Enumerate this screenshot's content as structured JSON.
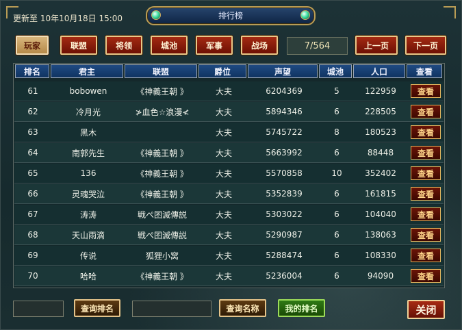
{
  "header": {
    "update_text": "更新至 10年10月18日 15:00",
    "title": "排行榜"
  },
  "tabs": [
    {
      "label": "玩家",
      "active": true
    },
    {
      "label": "联盟",
      "active": false
    },
    {
      "label": "将领",
      "active": false
    },
    {
      "label": "城池",
      "active": false
    },
    {
      "label": "军事",
      "active": false
    },
    {
      "label": "战场",
      "active": false
    }
  ],
  "pager": {
    "indicator": "7/564",
    "prev_label": "上一页",
    "next_label": "下一页"
  },
  "table": {
    "columns": [
      "排名",
      "君主",
      "联盟",
      "爵位",
      "声望",
      "城池",
      "人口",
      "查看"
    ],
    "view_label": "查看",
    "rows": [
      {
        "rank": "61",
        "lord": "bobowen",
        "alliance": "《神義王朝 》",
        "title": "大夫",
        "prestige": "6204369",
        "cities": "5",
        "population": "122959"
      },
      {
        "rank": "62",
        "lord": "冷月光",
        "alliance": "≯血色☆浪漫≮",
        "title": "大夫",
        "prestige": "5894346",
        "cities": "6",
        "population": "228505"
      },
      {
        "rank": "63",
        "lord": "黑木",
        "alliance": "",
        "title": "大夫",
        "prestige": "5745722",
        "cities": "8",
        "population": "180523"
      },
      {
        "rank": "64",
        "lord": "南郭先生",
        "alliance": "《神義王朝 》",
        "title": "大夫",
        "prestige": "5663992",
        "cities": "6",
        "population": "88448"
      },
      {
        "rank": "65",
        "lord": "136",
        "alliance": "《神義王朝 》",
        "title": "大夫",
        "prestige": "5570858",
        "cities": "10",
        "population": "352402"
      },
      {
        "rank": "66",
        "lord": "灵魂哭泣",
        "alliance": "《神義王朝 》",
        "title": "大夫",
        "prestige": "5352839",
        "cities": "6",
        "population": "161815"
      },
      {
        "rank": "67",
        "lord": "涛涛",
        "alliance": "戦ぺ囨滅傳説",
        "title": "大夫",
        "prestige": "5303022",
        "cities": "6",
        "population": "104040"
      },
      {
        "rank": "68",
        "lord": "天山雨滴",
        "alliance": "戦ぺ囨滅傳説",
        "title": "大夫",
        "prestige": "5290987",
        "cities": "6",
        "population": "138063"
      },
      {
        "rank": "69",
        "lord": "传说",
        "alliance": "狐狸小窝",
        "title": "大夫",
        "prestige": "5288474",
        "cities": "6",
        "population": "108330"
      },
      {
        "rank": "70",
        "lord": "哈哈",
        "alliance": "《神義王朝 》",
        "title": "大夫",
        "prestige": "5236004",
        "cities": "6",
        "population": "94090"
      }
    ]
  },
  "footer": {
    "rank_input_value": "",
    "query_rank_label": "查询排名",
    "name_input_value": "",
    "query_name_label": "查询名称",
    "my_rank_label": "我的排名",
    "close_label": "关闭"
  }
}
